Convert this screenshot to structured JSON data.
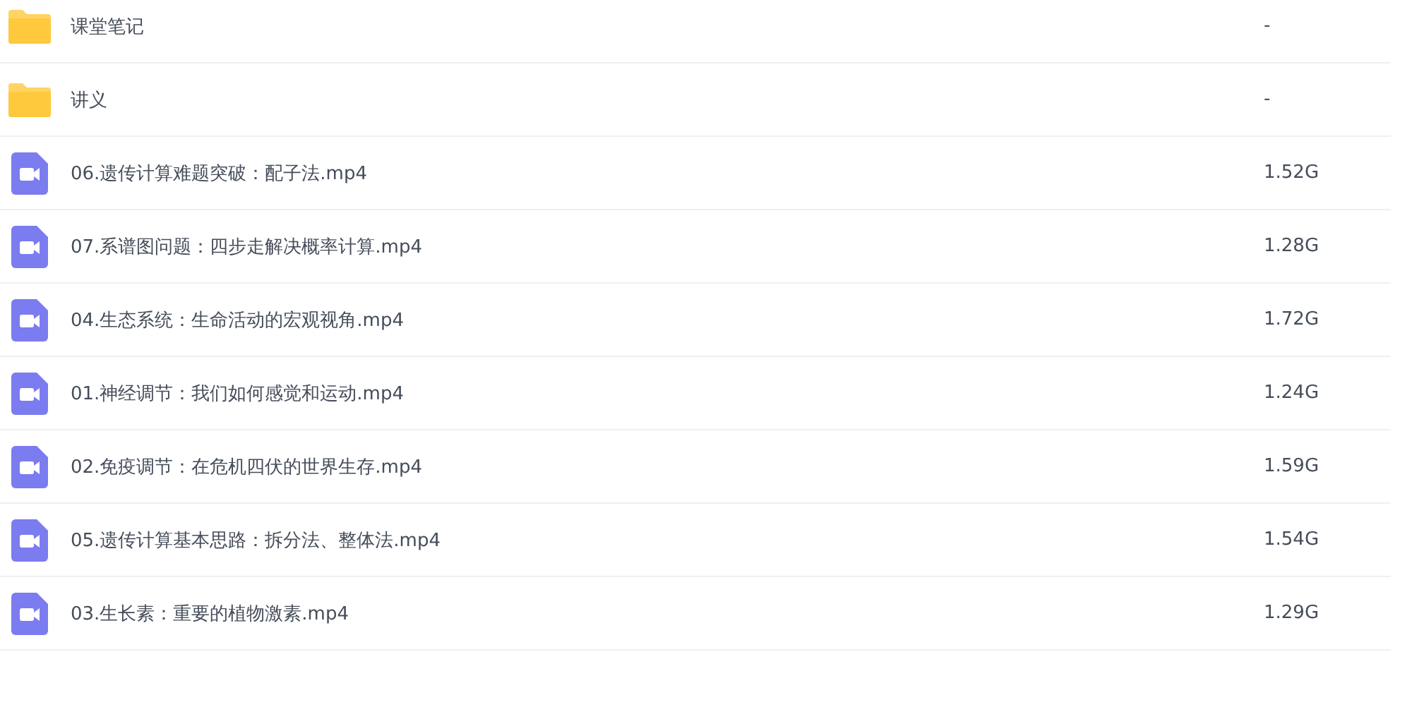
{
  "files": [
    {
      "kind": "folder",
      "name": "课堂笔记",
      "size": "-"
    },
    {
      "kind": "folder",
      "name": "讲义",
      "size": "-"
    },
    {
      "kind": "video",
      "name": "06.遗传计算难题突破：配子法.mp4",
      "size": "1.52G"
    },
    {
      "kind": "video",
      "name": "07.系谱图问题：四步走解决概率计算.mp4",
      "size": "1.28G"
    },
    {
      "kind": "video",
      "name": "04.生态系统：生命活动的宏观视角.mp4",
      "size": "1.72G"
    },
    {
      "kind": "video",
      "name": "01.神经调节：我们如何感觉和运动.mp4",
      "size": "1.24G"
    },
    {
      "kind": "video",
      "name": "02.免疫调节：在危机四伏的世界生存.mp4",
      "size": "1.59G"
    },
    {
      "kind": "video",
      "name": "05.遗传计算基本思路：拆分法、整体法.mp4",
      "size": "1.54G"
    },
    {
      "kind": "video",
      "name": "03.生长素：重要的植物激素.mp4",
      "size": "1.29G"
    }
  ]
}
